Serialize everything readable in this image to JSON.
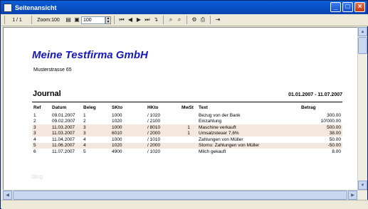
{
  "window": {
    "title": "Seitenansicht"
  },
  "toolbar": {
    "page_indicator": "1 / 1",
    "zoom_label": "Zoom:100",
    "zoom_value": "100"
  },
  "report": {
    "company": "Meine Testfirma GmbH",
    "street": "Musterstrasse 65",
    "heading": "Journal",
    "date_range": "01.01.2007 - 11.07.2007",
    "columns": [
      "Ref",
      "Datum",
      "Beleg",
      "SKto",
      "HKto",
      "MwSt",
      "Text",
      "Betrag"
    ],
    "rows": [
      [
        "1",
        "09.01.2007",
        "1",
        "1000",
        "/ 1020",
        "",
        "Bezug von der Bank",
        "300.00"
      ],
      [
        "2",
        "09.02.2007",
        "2",
        "1020",
        "/ 2100",
        "",
        "Einzahlung",
        "10'000.00"
      ],
      [
        "3",
        "11.03.2007",
        "3",
        "1000",
        "/ 8010",
        "1",
        "Maschine verkauft",
        "500.00"
      ],
      [
        "3",
        "11.03.2007",
        "3",
        "6010",
        "/ 2000",
        "1",
        "Umsatzsteuer 7,6%",
        "38.00"
      ],
      [
        "4",
        "11.04.2007",
        "4",
        "1000",
        "/ 1010",
        "",
        "Zahlungen von Müller",
        "50.00"
      ],
      [
        "5",
        "11.06.2007",
        "4",
        "1020",
        "/ 2000",
        "",
        "Storno: Zahlungen von Müller",
        "-50.00"
      ],
      [
        "6",
        "11.07.2007",
        "5",
        "4900",
        "/ 1020",
        "",
        "Milch gekauft",
        "8.00"
      ]
    ],
    "watermark": "blog"
  }
}
